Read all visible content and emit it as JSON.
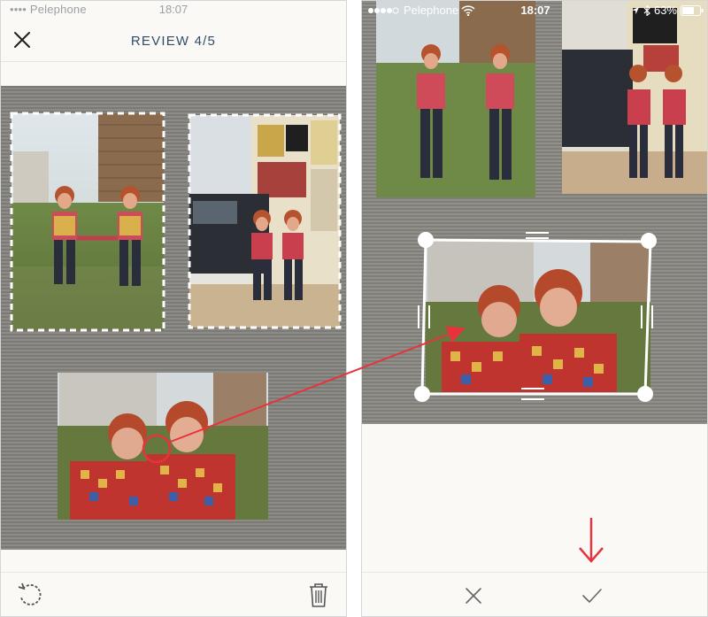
{
  "left_screen": {
    "status": {
      "carrier": "•••• Pelephone",
      "time": "18:07"
    },
    "header": {
      "title": "REVIEW 4/5"
    },
    "icons": {
      "close": "close-icon",
      "rotate": "rotate-icon",
      "trash": "trash-icon"
    }
  },
  "right_screen": {
    "status": {
      "carrier": "Pelephone",
      "time": "18:07",
      "battery": "63%"
    },
    "icons": {
      "cancel": "close-icon",
      "confirm": "checkmark-icon"
    }
  },
  "annotation": {
    "color": "#e8333c"
  }
}
